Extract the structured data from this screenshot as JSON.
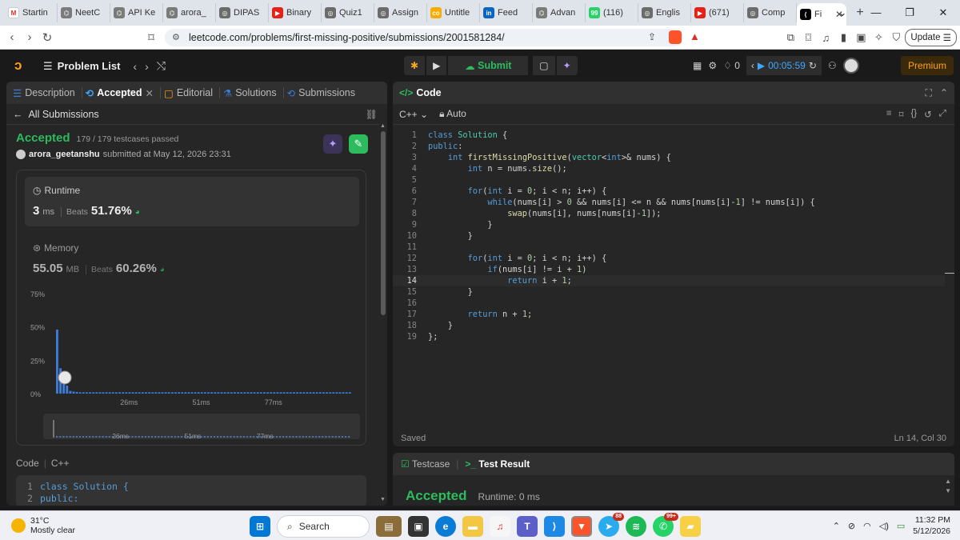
{
  "browser": {
    "tabs": [
      {
        "label": "Startin",
        "color": "#ffffff",
        "glyph": "M"
      },
      {
        "label": "NeetC",
        "color": "#7a7a7a",
        "glyph": "⌬"
      },
      {
        "label": "API Ke",
        "color": "#7a7a7a",
        "glyph": "⌬"
      },
      {
        "label": "arora_",
        "color": "#7a7a7a",
        "glyph": "⌬"
      },
      {
        "label": "DIPAS",
        "color": "#6b6b6b",
        "glyph": "◎"
      },
      {
        "label": "Binary",
        "color": "#e62117",
        "glyph": "▶"
      },
      {
        "label": "Quiz1",
        "color": "#6b6b6b",
        "glyph": "◎"
      },
      {
        "label": "Assign",
        "color": "#6b6b6b",
        "glyph": "◎"
      },
      {
        "label": "Untitle",
        "color": "#f9ab00",
        "glyph": "co"
      },
      {
        "label": "Feed",
        "color": "#0a66c2",
        "glyph": "in"
      },
      {
        "label": "Advan",
        "color": "#7a7a7a",
        "glyph": "⌬"
      },
      {
        "label": "(116)",
        "color": "#25d366",
        "glyph": "99"
      },
      {
        "label": "Englis",
        "color": "#6b6b6b",
        "glyph": "◎"
      },
      {
        "label": "(671)",
        "color": "#e62117",
        "glyph": "▶"
      },
      {
        "label": "Comp",
        "color": "#6b6b6b",
        "glyph": "◎"
      }
    ],
    "active_tab": {
      "label": "Fi",
      "glyph": "⟨"
    },
    "url": "leetcode.com/problems/first-missing-positive/submissions/2001581284/",
    "update_label": "Update"
  },
  "topbar": {
    "problem_list": "Problem List",
    "submit_label": "Submit",
    "streak": "0",
    "timer": "00:05:59",
    "premium": "Premium"
  },
  "left": {
    "tabs": [
      {
        "label": "Description",
        "icon": "☰"
      },
      {
        "label": "Accepted",
        "icon": "⟲"
      },
      {
        "label": "Editorial",
        "icon": "▢"
      },
      {
        "label": "Solutions",
        "icon": "⚗"
      },
      {
        "label": "Submissions",
        "icon": "⟲"
      }
    ],
    "all_submissions": "All Submissions",
    "status": "Accepted",
    "testcases": "179 / 179 testcases passed",
    "user": "arora_geetanshu",
    "submitted_at": "submitted at May 12, 2026 23:31",
    "runtime": {
      "label": "Runtime",
      "value": "3",
      "unit": "ms",
      "beats_label": "Beats",
      "beats": "51.76%"
    },
    "memory": {
      "label": "Memory",
      "value": "55.05",
      "unit": "MB",
      "beats_label": "Beats",
      "beats": "60.26%"
    },
    "code_label": "Code",
    "code_lang": "C++",
    "preview": [
      {
        "n": "1",
        "text": "class Solution {"
      },
      {
        "n": "2",
        "text": "public:"
      }
    ]
  },
  "chart_data": {
    "type": "bar",
    "title": "",
    "xlabel": "",
    "ylabel": "",
    "yticks": [
      "0%",
      "25%",
      "50%",
      "75%"
    ],
    "ylim": [
      0,
      75
    ],
    "xticks": [
      "26ms",
      "51ms",
      "77ms"
    ],
    "navigator_ticks": [
      "26ms",
      "51ms",
      "77ms"
    ],
    "highlight_bar": 0,
    "values": [
      48,
      19,
      10,
      6,
      2,
      1.5,
      1.2,
      1,
      1,
      1,
      1,
      1,
      1,
      1,
      1,
      1,
      1,
      1,
      1,
      1,
      1,
      1,
      1,
      1,
      1,
      1,
      1,
      1,
      1,
      1,
      1,
      1,
      1,
      1,
      1,
      1,
      1,
      1,
      1,
      1,
      1,
      1,
      1,
      1,
      1,
      1,
      1,
      1,
      1,
      1,
      1,
      1,
      1,
      1,
      1,
      1,
      1,
      1,
      1,
      1,
      1,
      1,
      1,
      1,
      1,
      1,
      1,
      1,
      1,
      1,
      1,
      1,
      1,
      1,
      1,
      1,
      1,
      1,
      1,
      1,
      1,
      1,
      1,
      1,
      1,
      1,
      1,
      1,
      1,
      1
    ]
  },
  "editor": {
    "title": "Code",
    "language": "C++",
    "mode": "Auto",
    "cursor_line": 14,
    "lines": [
      "class Solution {",
      "public:",
      "    int firstMissingPositive(vector<int>& nums) {",
      "        int n = nums.size();",
      "",
      "        for(int i = 0; i < n; i++) {",
      "            while(nums[i] > 0 && nums[i] <= n && nums[nums[i]-1] != nums[i]) {",
      "                swap(nums[i], nums[nums[i]-1]);",
      "            }",
      "        }",
      "",
      "        for(int i = 0; i < n; i++) {",
      "            if(nums[i] != i + 1)",
      "                return i + 1;",
      "        }",
      "",
      "        return n + 1;",
      "    }",
      "};"
    ],
    "saved": "Saved",
    "position": "Ln 14, Col 30"
  },
  "test": {
    "testcase_tab": "Testcase",
    "result_tab": "Test Result",
    "status": "Accepted",
    "runtime": "Runtime: 0 ms"
  },
  "taskbar": {
    "temp": "31°C",
    "weather": "Mostly clear",
    "search": "Search",
    "badge_telegram": "88",
    "badge_whatsapp": "99+",
    "time": "11:32 PM",
    "date": "5/12/2026"
  }
}
